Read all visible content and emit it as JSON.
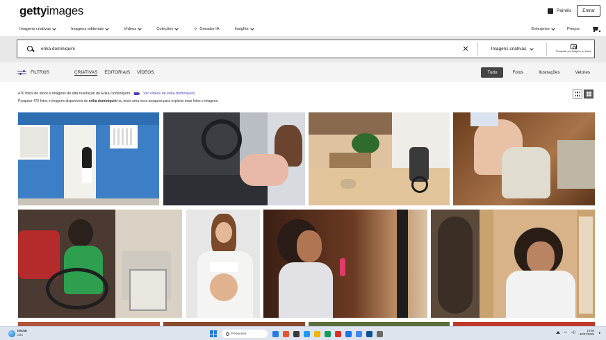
{
  "header": {
    "logo_bold": "getty",
    "logo_light": "images",
    "boards_label": "Painéis",
    "login_label": "Entrar"
  },
  "nav": {
    "items": [
      {
        "label": "Imagens criativas"
      },
      {
        "label": "Imagens editoriais"
      },
      {
        "label": "Vídeos"
      },
      {
        "label": "Coleções"
      },
      {
        "label": "Gerador IA"
      },
      {
        "label": "Insights"
      }
    ],
    "enterprise_label": "Enterprise",
    "pricing_label": "Preços"
  },
  "search": {
    "value": "erika dominiquini",
    "type_label": "Imagens criativas",
    "image_search_label": "Pesquisar por imagem ou vídeo"
  },
  "filters": {
    "filters_label": "FILTROS",
    "tabs": [
      {
        "label": "CRIATIVAS"
      },
      {
        "label": "EDITORIAIS"
      },
      {
        "label": "VÍDEOS"
      }
    ],
    "media_types": [
      {
        "label": "Tudo"
      },
      {
        "label": "Fotos"
      },
      {
        "label": "Ilustrações"
      },
      {
        "label": "Vetores"
      }
    ]
  },
  "results": {
    "summary": "470 fotos de stock e imagens de  alta resolução de Erika Dominiquini",
    "video_link": "Ver vídeos de erika dominiquini",
    "hint_prefix": "Pesquise 470 fotos e imagens disponíveis de ",
    "hint_query": "erika dominiquini",
    "hint_suffix": " ou inicie uma nova pesquisa para explorar mais fotos e imagens."
  },
  "taskbar": {
    "start_label": "Iniciar",
    "start_sub": "ado",
    "search_label": "Pesquisar",
    "time": "10:54",
    "date": "20/07/2024",
    "apps": [
      {
        "color": "#2b78e4"
      },
      {
        "color": "#e4572e"
      },
      {
        "color": "#3a3a3a"
      },
      {
        "color": "#1d9bf0"
      },
      {
        "color": "#f2b705"
      },
      {
        "color": "#0f9d58"
      },
      {
        "color": "#d93025"
      },
      {
        "color": "#1a73e8"
      },
      {
        "color": "#4285f4"
      },
      {
        "color": "#0b5394"
      },
      {
        "color": "#6a6a6a"
      }
    ]
  }
}
